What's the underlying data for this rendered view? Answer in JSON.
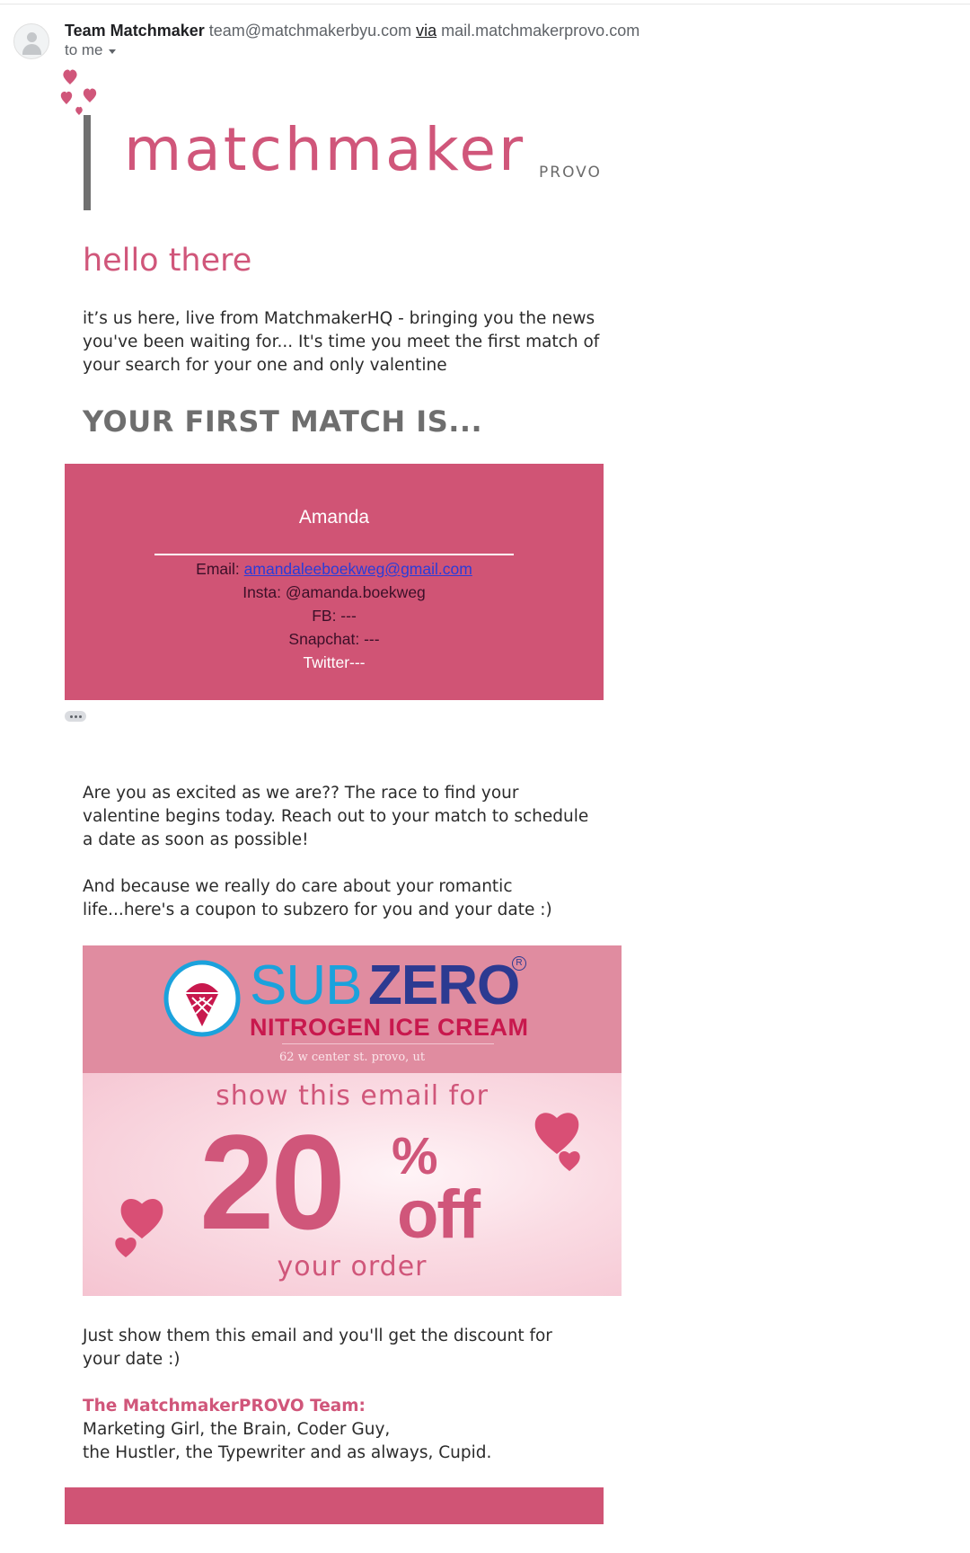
{
  "header": {
    "sender_name": "Team Matchmaker",
    "sender_email": "team@matchmakerbyu.com",
    "via_label": "via",
    "via_domain": "mail.matchmakerprovo.com",
    "recipient": "to me"
  },
  "logo": {
    "wordmark": "matchmaker",
    "sub": "PROVO",
    "icons": [
      "hearts-icon"
    ]
  },
  "greeting": "hello there",
  "intro": "it’s us here, live from MatchmakerHQ - bringing you the news\nyou've been waiting for... It's time you meet the first match of\nyour search for your one and only valentine",
  "first_match_heading": "YOUR FIRST MATCH IS...",
  "match": {
    "name": "Amanda",
    "email_label": "Email: ",
    "email": "amandaleeboekweg@gmail.com",
    "insta": "Insta: @amanda.boekweg",
    "fb": "FB: ---",
    "snapchat": "Snapchat: ---",
    "twitter": "Twitter---"
  },
  "body": {
    "excited": "Are you as excited as we are?? The race to find your\nvalentine begins today. Reach out to your match to schedule\na date as soon as possible!",
    "romantic": "And because we really do care about your romantic\nlife...here's a coupon to subzero for you and your date :)",
    "discount": "Just show them this email and you'll get the discount for\nyour date :)"
  },
  "coupon": {
    "brand_sub": "SUB",
    "brand_zero": "ZERO",
    "registered": "R",
    "tagline": "NITROGEN ICE CREAM",
    "address": "62 w center st. provo, ut",
    "show_for": "show this email for",
    "amount": "20",
    "percent": "%",
    "off": "off",
    "your_order": "your order",
    "icons": [
      "ice-cream-cone-icon",
      "heart-icon"
    ]
  },
  "signature": {
    "title": "The MatchmakerPROVO Team:",
    "line1": "Marketing Girl, the Brain, Coder Guy,",
    "line2": "the Hustler, the Typewriter and as always, Cupid."
  },
  "colors": {
    "brand_pink": "#d0567a",
    "card_pink": "#d05475",
    "subzero_blue": "#1ba2dc",
    "subzero_navy": "#2c3a91"
  }
}
